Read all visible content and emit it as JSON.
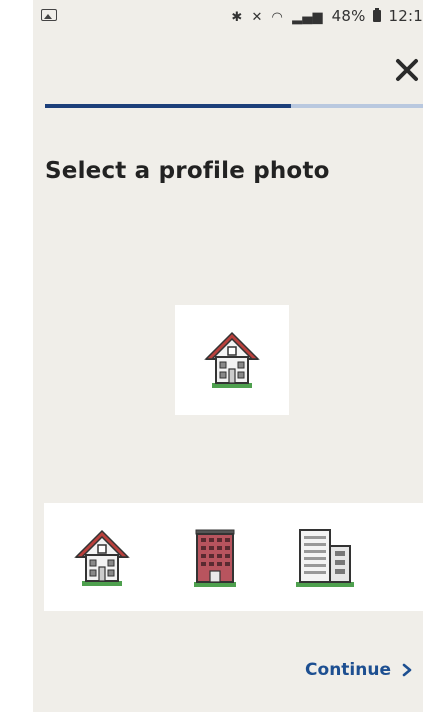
{
  "status_bar": {
    "battery_percent": "48%",
    "time": "12:1",
    "icons": [
      "image-notification-icon",
      "bluetooth-icon",
      "mute-icon",
      "wifi-icon",
      "signal-icon",
      "battery-icon"
    ]
  },
  "header": {
    "close_icon": "close-icon",
    "progress_fraction": 0.65
  },
  "main": {
    "title": "Select a profile photo",
    "selected_photo": "house-icon",
    "options": [
      {
        "icon": "house-icon"
      },
      {
        "icon": "apartment-building-icon"
      },
      {
        "icon": "office-building-icon"
      },
      {
        "icon": "partial-icon"
      }
    ]
  },
  "footer": {
    "continue_label": "Continue",
    "continue_icon": "chevron-right-icon"
  },
  "colors": {
    "background": "#f0eee9",
    "accent": "#1c3f7a",
    "progress_track": "#b9c8df",
    "link": "#1d4f91"
  }
}
